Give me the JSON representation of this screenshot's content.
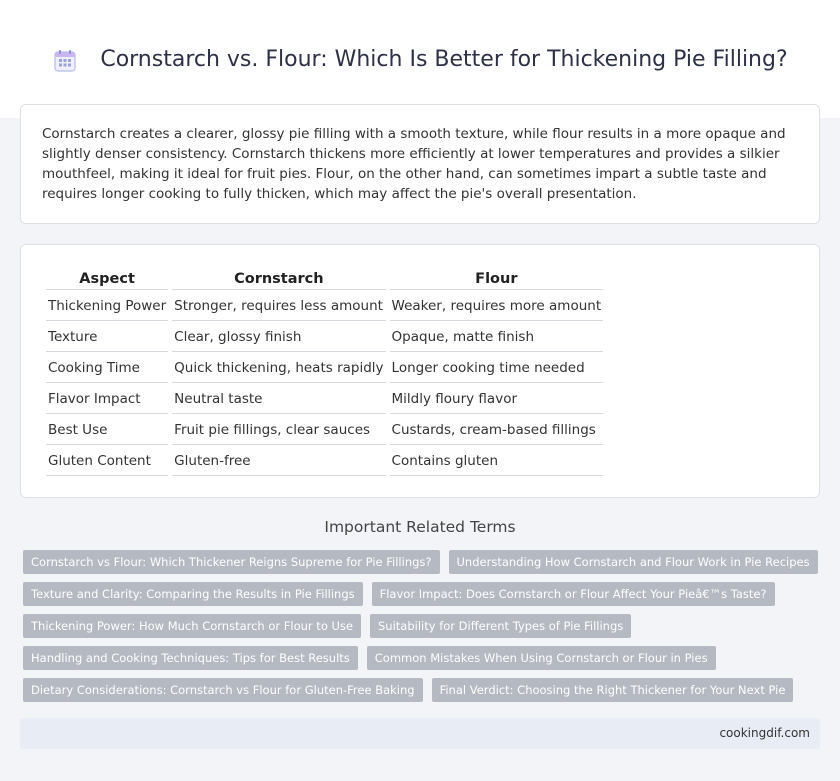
{
  "header": {
    "icon": "calendar-grid-icon",
    "title": "Cornstarch vs. Flour: Which Is Better for Thickening Pie Filling?"
  },
  "intro": {
    "text": "Cornstarch creates a clearer, glossy pie filling with a smooth texture, while flour results in a more opaque and slightly denser consistency. Cornstarch thickens more efficiently at lower temperatures and provides a silkier mouthfeel, making it ideal for fruit pies. Flour, on the other hand, can sometimes impart a subtle taste and requires longer cooking to fully thicken, which may affect the pie's overall presentation."
  },
  "table": {
    "headers": [
      "Aspect",
      "Cornstarch",
      "Flour"
    ],
    "rows": [
      [
        "Thickening Power",
        "Stronger, requires less amount",
        "Weaker, requires more amount"
      ],
      [
        "Texture",
        "Clear, glossy finish",
        "Opaque, matte finish"
      ],
      [
        "Cooking Time",
        "Quick thickening, heats rapidly",
        "Longer cooking time needed"
      ],
      [
        "Flavor Impact",
        "Neutral taste",
        "Mildly floury flavor"
      ],
      [
        "Best Use",
        "Fruit pie fillings, clear sauces",
        "Custards, cream-based fillings"
      ],
      [
        "Gluten Content",
        "Gluten-free",
        "Contains gluten"
      ]
    ]
  },
  "related": {
    "title": "Important Related Terms",
    "tags": [
      [
        "Cornstarch vs Flour: Which Thickener Reigns Supreme for Pie Fillings?",
        "Understanding How Cornstarch and Flour Work in Pie Recipes"
      ],
      [
        "Texture and Clarity: Comparing the Results in Pie Fillings",
        "Flavor Impact: Does Cornstarch or Flour Affect Your Pieâ€™s Taste?"
      ],
      [
        "Thickening Power: How Much Cornstarch or Flour to Use",
        "Suitability for Different Types of Pie Fillings"
      ],
      [
        "Handling and Cooking Techniques: Tips for Best Results",
        "Common Mistakes When Using Cornstarch or Flour in Pies"
      ],
      [
        "Dietary Considerations: Cornstarch vs Flour for Gluten-Free Baking",
        "Final Verdict: Choosing the Right Thickener for Your Next Pie"
      ]
    ]
  },
  "footer": {
    "site": "cookingdif.com"
  }
}
